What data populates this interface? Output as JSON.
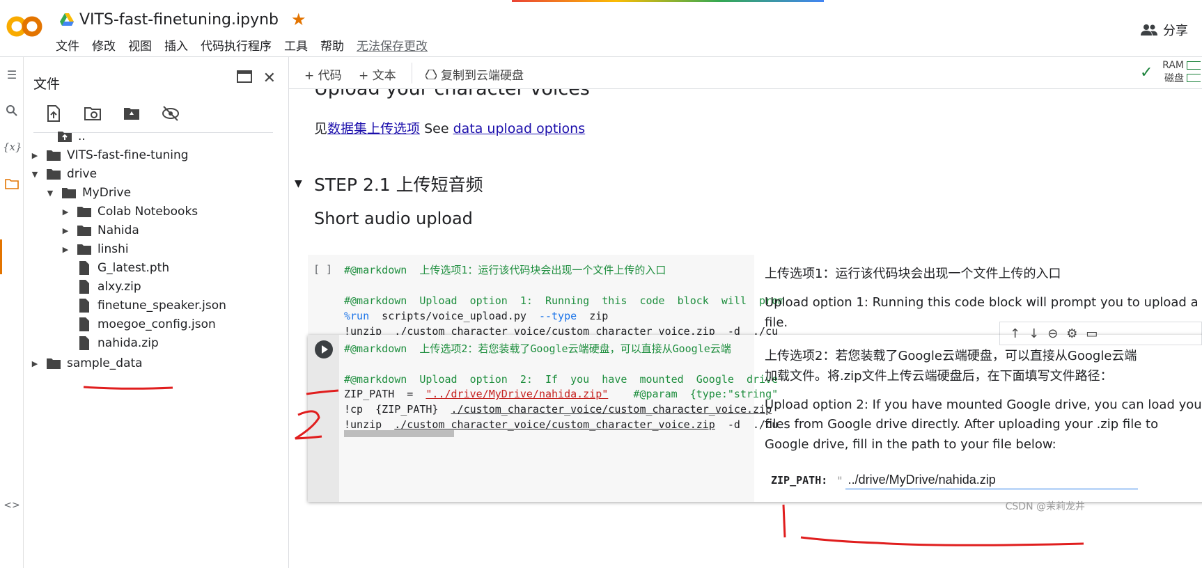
{
  "app": {
    "doc_title": "VITS-fast-finetuning.ipynb",
    "menu": [
      "文件",
      "修改",
      "视图",
      "插入",
      "代码执行程序",
      "工具",
      "帮助"
    ],
    "unsaved": "无法保存更改",
    "share_label": "分享"
  },
  "files_panel": {
    "title": "文件",
    "tree": [
      {
        "label": "..",
        "type": "parent"
      },
      {
        "label": "VITS-fast-fine-tuning",
        "type": "folder"
      },
      {
        "label": "drive",
        "type": "folder"
      },
      {
        "label": "MyDrive",
        "type": "folder"
      },
      {
        "label": "Colab Notebooks",
        "type": "folder"
      },
      {
        "label": "Nahida",
        "type": "folder"
      },
      {
        "label": "linshi",
        "type": "folder"
      },
      {
        "label": "G_latest.pth",
        "type": "file"
      },
      {
        "label": "alxy.zip",
        "type": "file"
      },
      {
        "label": "finetune_speaker.json",
        "type": "file"
      },
      {
        "label": "moegoe_config.json",
        "type": "file"
      },
      {
        "label": "nahida.zip",
        "type": "file"
      },
      {
        "label": "sample_data",
        "type": "folder"
      }
    ]
  },
  "toolbar": {
    "add_code": "+ 代码",
    "add_text": "+ 文本",
    "copy_drive": "复制到云端硬盘",
    "ram": "RAM",
    "disk": "磁盘"
  },
  "notebook": {
    "heading_top": "Upload your character voices",
    "link_prefix": "见",
    "link_cn": "数据集上传选项",
    "link_mid": " See ",
    "link_en": "data upload options",
    "step_heading": "STEP 2.1 上传短音频",
    "short_heading": "Short audio upload",
    "cell1": {
      "bracket": "[ ]",
      "line1": "#@markdown  上传选项1：运行该代码块会出现一个文件上传的入口",
      "line2": "#@markdown  Upload  option  1:  Running  this  code  block  will  prom",
      "line3_kw": "%run",
      "line3_rest": "  scripts/voice_upload.py  ",
      "line3_kw2": "--type",
      "line3_tail": "  zip",
      "line4_a": "!unzip  ",
      "line4_b": "./custom_character_voice/custom_character_voice.zip",
      "line4_c": "  -d  ./cu",
      "form_cn": "上传选项1：运行该代码块会出现一个文件上传的入口",
      "form_en": "Upload option 1: Running this code block will prompt you to upload a",
      "form_en2": "file."
    },
    "cell2": {
      "line1": "#@markdown  上传选项2：若您装载了Google云端硬盘，可以直接从Google云端",
      "line2": "#@markdown  Upload  option  2:  If  you  have  mounted  Google  drive",
      "line3_a": "ZIP_PATH  =  ",
      "line3_b": "\"../drive/MyDrive/nahida.zip\"",
      "line3_c": "    #@param  {type:\"string\"",
      "line4_a": "!cp  {ZIP_PATH}  ",
      "line4_b": "./custom_character_voice/custom_character_voice.zip",
      "line5_a": "!unzip  ",
      "line5_b": "./custom_character_voice/custom_character_voice.zip",
      "line5_c": "  -d  ./cu",
      "form_cn1": "上传选项2：若您装载了Google云端硬盘，可以直接从Google云端",
      "form_cn2": "加载文件。将.zip文件上传云端硬盘后，在下面填写文件路径：",
      "form_en1": "Upload option 2: If you have mounted Google drive, you can load your",
      "form_en2": "files from Google drive directly. After uploading your .zip file to",
      "form_en3": "Google drive, fill in the path to your file below:",
      "zip_label": "ZIP_PATH:",
      "zip_quote": "\"",
      "zip_value": "../drive/MyDrive/nahida.zip"
    }
  },
  "annotations": {
    "num2": "2",
    "num1": "1"
  },
  "watermark": "CSDN @茉莉龙井",
  "colors": {
    "accent": "#e37400",
    "annotation": "#e01e1e",
    "link": "#1a0dab",
    "comment": "#1e8e3e"
  }
}
